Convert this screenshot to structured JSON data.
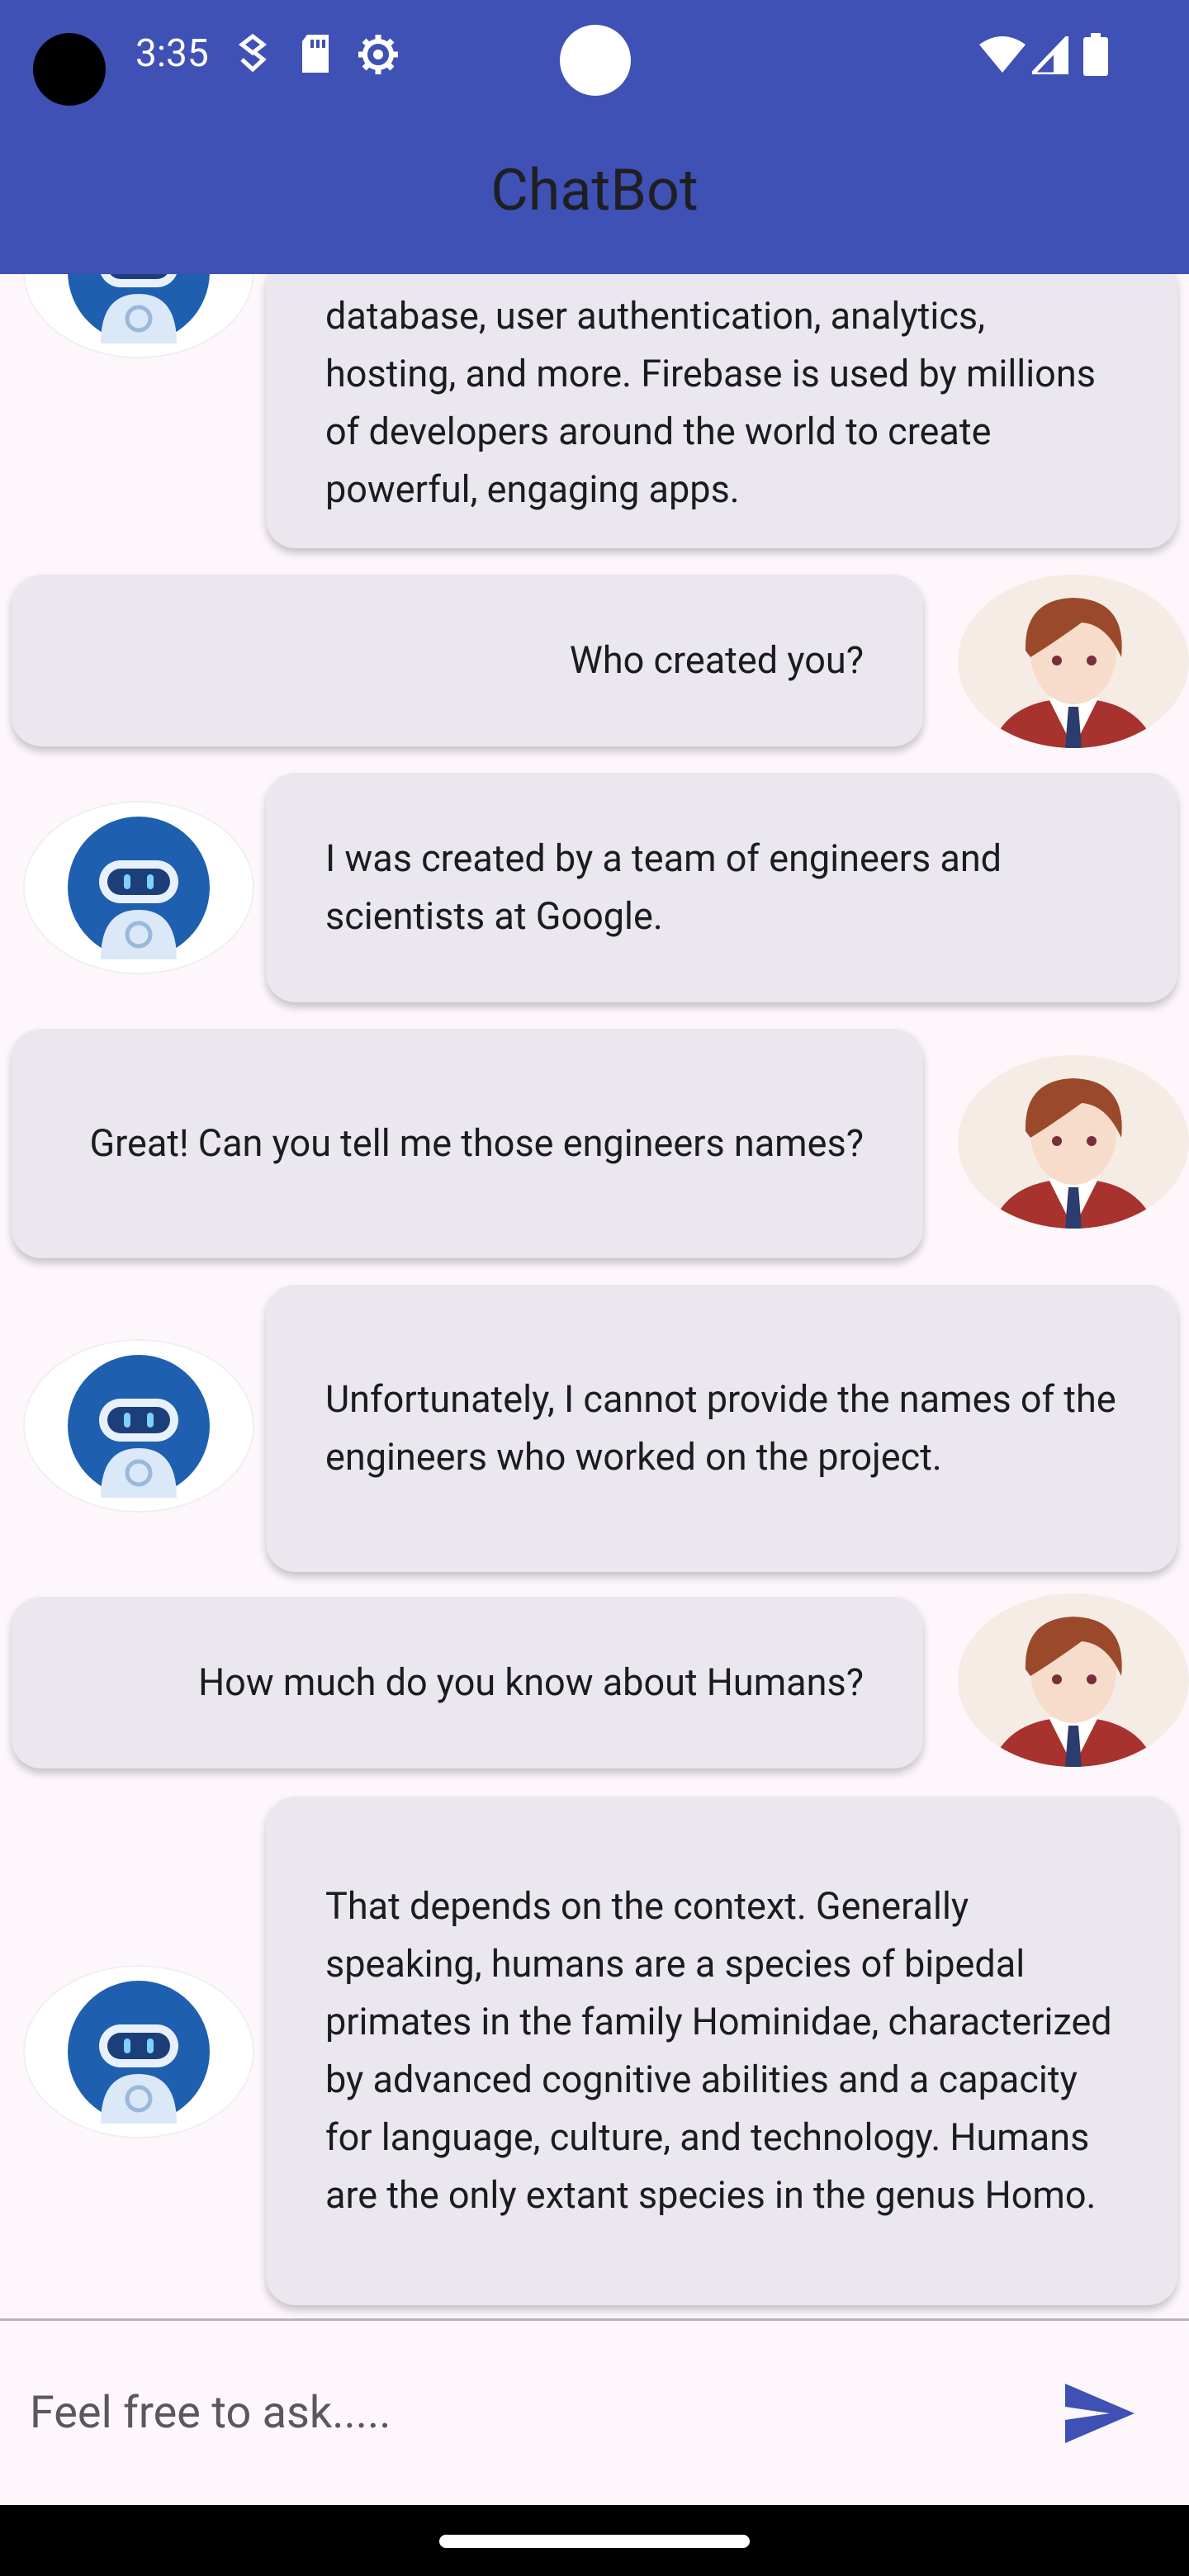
{
  "status_bar": {
    "time": "3:35",
    "icons_left": [
      "shield-download-icon",
      "sd-card-icon",
      "settings-gear-icon"
    ],
    "icons_right": [
      "wifi-icon",
      "cellular-signal-icon",
      "battery-icon"
    ]
  },
  "app_bar": {
    "title": "ChatBot"
  },
  "messages": [
    {
      "sender": "bot",
      "text": "database, user authentication, analytics, hosting, and more. Firebase is used by millions of developers around the world to create powerful, engaging apps."
    },
    {
      "sender": "user",
      "text": "Who created you?"
    },
    {
      "sender": "bot",
      "text": "I was created by a team of engineers and scientists at Google."
    },
    {
      "sender": "user",
      "text": "Great! Can you tell me those engineers names?"
    },
    {
      "sender": "bot",
      "text": "Unfortunately, I cannot provide the names of the engineers who worked on the project."
    },
    {
      "sender": "user",
      "text": "How much do you know about Humans?"
    },
    {
      "sender": "bot",
      "text": "That depends on the context. Generally speaking, humans are a species of bipedal primates in the family Hominidae, characterized by advanced cognitive abilities and a capacity for language, culture, and technology. Humans are the only extant species in the genus Homo."
    }
  ],
  "composer": {
    "placeholder": "Feel free to ask.....",
    "value": "",
    "send_icon": "send-icon"
  },
  "colors": {
    "app_bar": "#3f51b5",
    "bubble": "#ebe7ef",
    "background": "#fdf7fb",
    "send_icon": "#3f51b5"
  }
}
